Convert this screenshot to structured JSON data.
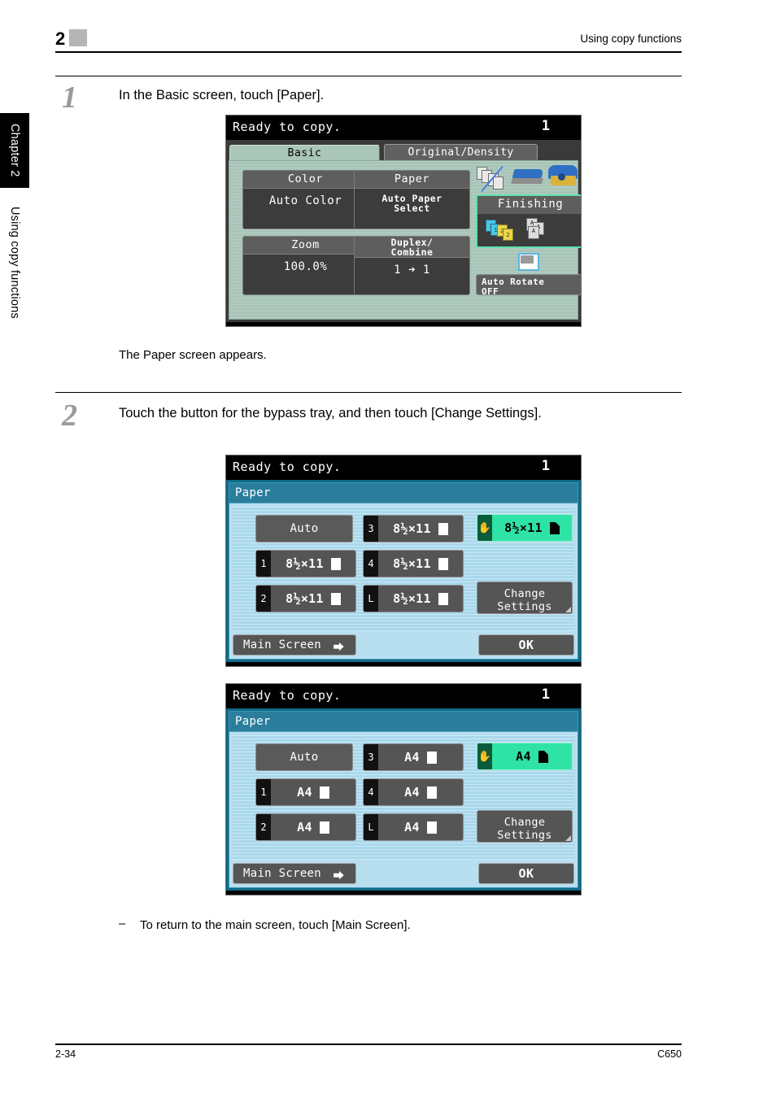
{
  "header": {
    "chapter_number": "2",
    "running_title": "Using copy functions"
  },
  "side_tabs": {
    "chapter": "Chapter 2",
    "section": "Using copy functions"
  },
  "steps": [
    {
      "number": "1",
      "text": "In the Basic screen, touch [Paper].",
      "note": "The Paper screen appears."
    },
    {
      "number": "2",
      "text": "Touch the button for the bypass tray, and then touch [Change Settings].",
      "bullet_dash": "–",
      "bullet": "To return to the main screen, touch [Main Screen]."
    }
  ],
  "basic_screen": {
    "status": "Ready to copy.",
    "count": "1",
    "tabs": {
      "active": "Basic",
      "inactive": "Original/Density"
    },
    "buttons": [
      {
        "caption": "Color",
        "value": "Auto Color"
      },
      {
        "caption": "Paper",
        "caption2": "",
        "value_line1": "Auto Paper",
        "value_line2": "Select"
      },
      {
        "caption": "Zoom",
        "value": "100.0%"
      },
      {
        "caption_line1": "Duplex/",
        "caption_line2": "Combine",
        "value": "1  ➜  1"
      }
    ],
    "finishing": {
      "label": "Finishing"
    },
    "auto_rotate": {
      "line1": "Auto Rotate",
      "line2": "OFF"
    },
    "icons": [
      "offset-icon",
      "staple-icon",
      "punch-icon",
      "collate-icon",
      "group-icon",
      "auto-rotate-icon"
    ]
  },
  "paper_screen_inch": {
    "status": "Ready to copy.",
    "count": "1",
    "title": "Paper",
    "auto_label": "Auto",
    "trays": [
      {
        "tab": "1",
        "size": "8½×11",
        "orientation": "portrait"
      },
      {
        "tab": "2",
        "size": "8½×11",
        "orientation": "portrait"
      },
      {
        "tab": "3",
        "size": "8½×11",
        "orientation": "portrait"
      },
      {
        "tab": "4",
        "size": "8½×11",
        "orientation": "portrait"
      },
      {
        "tab": "L",
        "size": "8½×11",
        "orientation": "portrait"
      }
    ],
    "bypass": {
      "tab": "hand-icon",
      "size": "8½×11",
      "selected": true
    },
    "change_settings": {
      "line1": "Change",
      "line2": "Settings"
    },
    "main_screen": "Main Screen",
    "ok": "OK"
  },
  "paper_screen_metric": {
    "status": "Ready to copy.",
    "count": "1",
    "title": "Paper",
    "auto_label": "Auto",
    "trays": [
      {
        "tab": "1",
        "size": "A4",
        "orientation": "portrait"
      },
      {
        "tab": "2",
        "size": "A4",
        "orientation": "portrait"
      },
      {
        "tab": "3",
        "size": "A4",
        "orientation": "portrait"
      },
      {
        "tab": "4",
        "size": "A4",
        "orientation": "portrait"
      },
      {
        "tab": "L",
        "size": "A4",
        "orientation": "portrait"
      }
    ],
    "bypass": {
      "tab": "hand-icon",
      "size": "A4",
      "selected": true
    },
    "change_settings": {
      "line1": "Change",
      "line2": "Settings"
    },
    "main_screen": "Main Screen",
    "ok": "OK"
  },
  "footer": {
    "page": "2-34",
    "model": "C650"
  },
  "colors": {
    "lcd_status_bg": "#000000",
    "basic_pane_bg": "#a8c5b8",
    "paper_title_bg": "#2a7e9c",
    "paper_pane_bg": "#a9d8ec",
    "selected_green": "#2fe3a6",
    "button_gray": "#555555",
    "chapter_tab_bg": "#000000"
  }
}
